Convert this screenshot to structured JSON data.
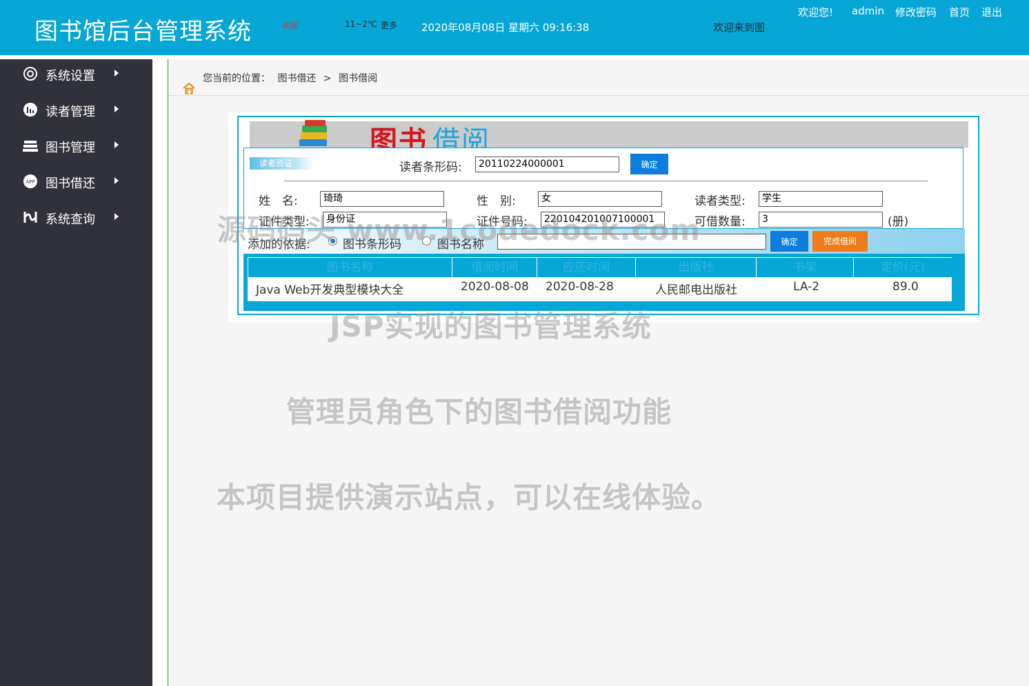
{
  "header": {
    "title": "图书馆后台管理系统",
    "weather_location": "未知",
    "weather_temp": "11~2℃",
    "weather_more": "更多",
    "datetime": "2020年08月08日 星期六 09:16:38",
    "marquee": "欢迎来到图",
    "welcome": "欢迎您!",
    "username": "admin",
    "change_password": "修改密码",
    "home": "首页",
    "logout": "退出"
  },
  "sidebar": {
    "items": [
      {
        "label": "系统设置",
        "icon": "gear-icon"
      },
      {
        "label": "读者管理",
        "icon": "chart-icon"
      },
      {
        "label": "图书管理",
        "icon": "books-stack-icon"
      },
      {
        "label": "图书借还",
        "icon": "app-icon"
      },
      {
        "label": "系统查询",
        "icon": "query-icon"
      }
    ]
  },
  "breadcrumb": {
    "prefix": "您当前的位置：",
    "level1": "图书借还",
    "separator": ">",
    "level2": "图书借阅"
  },
  "banner": {
    "title_red": "图书",
    "title_blue": "借阅"
  },
  "reader": {
    "tag": "读者验证",
    "barcode_label": "读者条形码:",
    "barcode_value": "20110224000001",
    "confirm": "确定",
    "name_label": "姓　名:",
    "name_value": "琦琦",
    "gender_label": "性　别:",
    "gender_value": "女",
    "type_label": "读者类型:",
    "type_value": "学生",
    "cert_type_label": "证件类型:",
    "cert_type_value": "身份证",
    "cert_no_label": "证件号码:",
    "cert_no_value": "220104201007100001",
    "borrowable_label": "可借数量:",
    "borrowable_value": "3",
    "borrowable_unit": "(册)"
  },
  "add_by": {
    "label": "添加的依据:",
    "option_barcode": "图书条形码",
    "option_name": "图书名称",
    "selected": "图书条形码",
    "input_value": "",
    "confirm": "确定",
    "finish": "完成借阅"
  },
  "table": {
    "columns": [
      "图书名称",
      "借阅时间",
      "应还时间",
      "出版社",
      "书架",
      "定价(元)"
    ],
    "rows": [
      [
        "Java Web开发典型模块大全",
        "2020-08-08",
        "2020-08-28",
        "人民邮电出版社",
        "LA-2",
        "89.0"
      ]
    ]
  },
  "watermarks": {
    "line1": "源码码头 www.1codedock.com",
    "line2": "JSP实现的图书管理系统",
    "line3": "管理员角色下的图书借阅功能",
    "line4": "本项目提供演示站点，可以在线体验。"
  },
  "colors": {
    "header_bg": "#06a6d6",
    "sidebar_bg": "#30313a",
    "accent_blue": "#0b7ee0",
    "accent_orange": "#f07b1a"
  }
}
